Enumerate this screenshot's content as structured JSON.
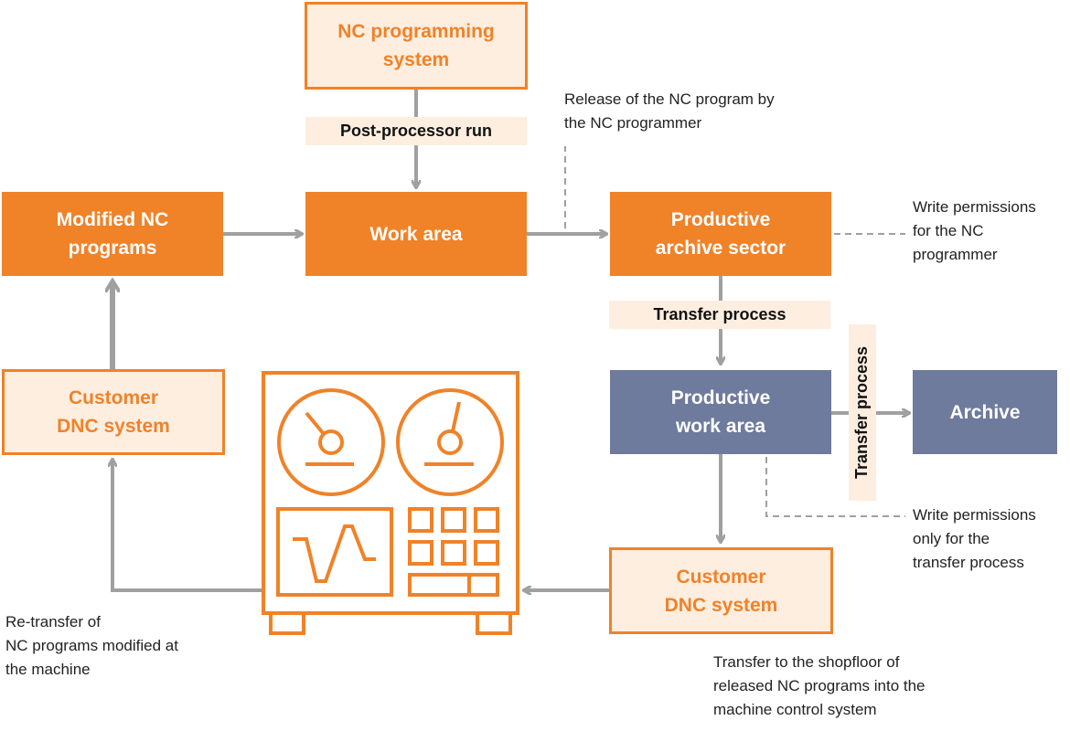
{
  "colors": {
    "orange": "#f08228",
    "light": "#fdeee0",
    "blue": "#6e7b9d",
    "arrow": "#a0a0a0"
  },
  "nodes": {
    "nc_programming": "NC programming\nsystem",
    "modified": "Modified NC\nprograms",
    "work_area": "Work area",
    "productive_archive": "Productive\narchive sector",
    "customer_dnc_left": "Customer\nDNC system",
    "productive_work": "Productive\nwork area",
    "archive": "Archive",
    "customer_dnc_bottom": "Customer\nDNC system"
  },
  "labels": {
    "post_processor": "Post-processor run",
    "transfer1": "Transfer process",
    "transfer2": "Transfer process"
  },
  "notes": {
    "release": "Release of the NC program by\nthe NC programmer",
    "write_nc": "Write permissions\nfor the NC\nprogrammer",
    "write_transfer": "Write permissions\nonly for the\ntransfer process",
    "retransfer": "Re-transfer of\nNC programs modified at\nthe machine",
    "shopfloor": "Transfer to the shopfloor of\nreleased NC programs into the\nmachine control system"
  },
  "icons": {
    "machine": "machine-control-icon"
  }
}
